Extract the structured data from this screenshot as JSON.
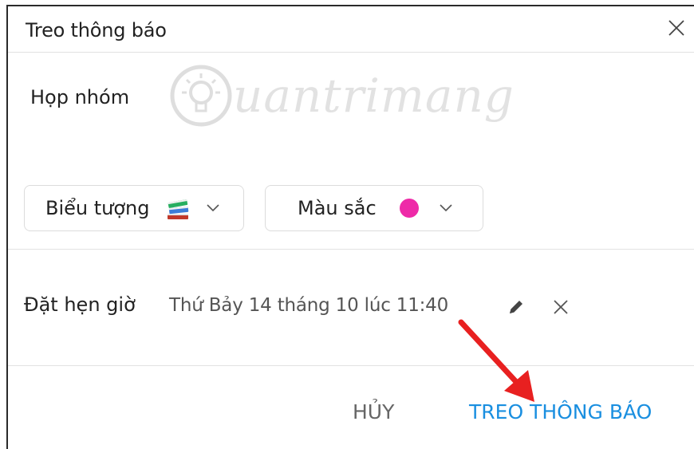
{
  "dialog": {
    "title": "Treo thông báo",
    "message": "Họp nhóm",
    "icon_label": "Biểu tượng",
    "color_label": "Màu sắc",
    "selected_color": "#ee2aa8",
    "schedule_label": "Đặt hẹn giờ",
    "schedule_value": "Thứ Bảy 14 tháng 10 lúc 11:40",
    "cancel_label": "HỦY",
    "post_label": "TREO THÔNG BÁO",
    "accent_color": "#1a8fe0"
  },
  "watermark": {
    "text": "uantrimang"
  },
  "icons": [
    "close-icon",
    "books-icon",
    "chevron-down-icon",
    "pencil-icon",
    "clear-icon",
    "lightbulb-icon"
  ],
  "annotation": {
    "color": "#e82020"
  }
}
